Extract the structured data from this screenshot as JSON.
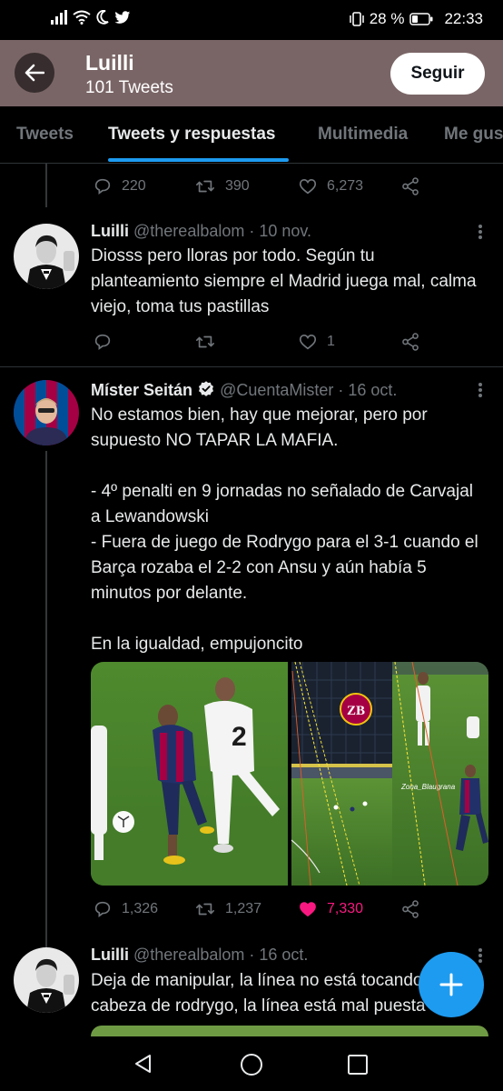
{
  "status_bar": {
    "battery": "28 %",
    "time": "22:33"
  },
  "header": {
    "name": "Luilli",
    "subtitle": "101 Tweets",
    "follow_label": "Seguir"
  },
  "tabs": [
    {
      "label": "Tweets"
    },
    {
      "label": "Tweets y respuestas",
      "active": true
    },
    {
      "label": "Multimedia"
    },
    {
      "label": "Me gus"
    }
  ],
  "prev_tweet_actions": {
    "replies": "220",
    "retweets": "390",
    "likes": "6,273"
  },
  "tweets": [
    {
      "name": "Luilli",
      "handle": "@therealbalom · 10 nov.",
      "text": "Diosss pero lloras por todo. Según tu planteamiento siempre el Madrid juega mal, calma viejo, toma tus pastillas",
      "replies": "",
      "retweets": "",
      "likes": "1"
    },
    {
      "name": "Míster Seitán",
      "verified": true,
      "handle": "@CuentaMister · 16 oct.",
      "text": "No estamos bien, hay que mejorar, pero por supuesto NO TAPAR LA MAFIA.\n\n- 4º penalti en 9 jornadas no señalado de Carvajal a Lewandowski\n- Fuera de juego de Rodrygo para el 3-1 cuando el Barça rozaba el 2-2 con Ansu y aún había 5 minutos por delante.\n\nEn la igualdad, empujoncito",
      "media_watermark": "ZB",
      "media_caption": "Zona_Blaugrana",
      "replies": "1,326",
      "retweets": "1,237",
      "likes": "7,330",
      "liked": true
    },
    {
      "name": "Luilli",
      "handle": "@therealbalom · 16 oct.",
      "text": "Deja de manipular, la línea no está tocando la\ncabeza de rodrygo, la línea está mal puesta"
    }
  ],
  "colors": {
    "accent": "#1d9bf0",
    "like": "#f91880",
    "header_bg": "#7a6566"
  }
}
